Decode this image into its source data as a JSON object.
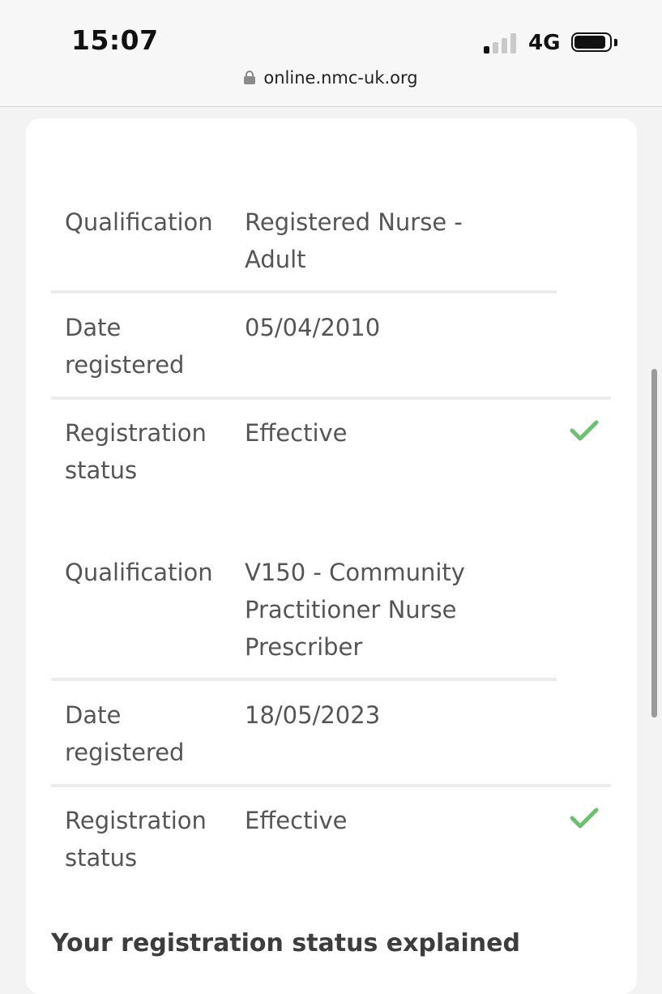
{
  "status_bar": {
    "time": "15:07",
    "network": "4G",
    "signal_bars_active": 1,
    "signal_bars_total": 4,
    "battery_icon": "battery-icon"
  },
  "browser": {
    "url": "online.nmc-uk.org",
    "lock_icon": "lock-icon"
  },
  "registrations": [
    {
      "qualification_label": "Qualification",
      "qualification_value": "Registered Nurse - Adult",
      "date_label": "Date registered",
      "date_value": "05/04/2010",
      "status_label": "Registration status",
      "status_value": "Effective",
      "status_icon": "check-icon"
    },
    {
      "qualification_label": "Qualification",
      "qualification_value": "V150 - Community Practitioner Nurse Prescriber",
      "date_label": "Date registered",
      "date_value": "18/05/2023",
      "status_label": "Registration status",
      "status_value": "Effective",
      "status_icon": "check-icon"
    }
  ],
  "section_heading": "Your registration status explained",
  "colors": {
    "check": "#6cc070",
    "text": "#555555",
    "divider": "#ececec"
  }
}
